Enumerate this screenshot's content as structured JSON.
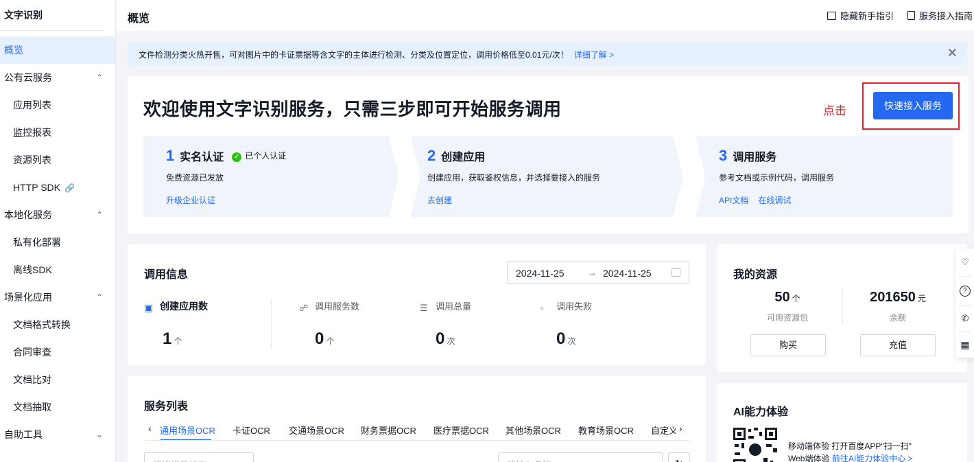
{
  "sidebar": {
    "title": "文字识别",
    "items": [
      {
        "label": "概览"
      },
      {
        "label": "公有云服务",
        "chevron": "^"
      },
      {
        "label": "应用列表"
      },
      {
        "label": "监控报表"
      },
      {
        "label": "资源列表"
      },
      {
        "label": "HTTP SDK"
      },
      {
        "label": "本地化服务",
        "chevron": "^"
      },
      {
        "label": "私有化部署"
      },
      {
        "label": "离线SDK"
      },
      {
        "label": "场景化应用",
        "chevron": "^"
      },
      {
        "label": "文档格式转换"
      },
      {
        "label": "合同审查"
      },
      {
        "label": "文档比对"
      },
      {
        "label": "文档抽取"
      },
      {
        "label": "自助工具",
        "chevron": "v"
      }
    ]
  },
  "header": {
    "title": "概览",
    "hide_guide": "隐藏新手指引",
    "service_guide": "服务接入指南"
  },
  "notice": {
    "text": "文件检测分类火热开售，可对图片中的卡证票据等含文字的主体进行检测、分类及位置定位，调用价格低至0.01元/次！",
    "link": "详细了解 >",
    "close": "✕"
  },
  "welcome": {
    "title": "欢迎使用文字识别服务，只需三步即可开始服务调用",
    "click_hint": "点击",
    "quick_button": "快速接入服务",
    "steps": [
      {
        "num": "1",
        "name": "实名认证",
        "badge": "已个人认证",
        "desc": "免费资源已发放",
        "links": [
          "升级企业认证"
        ]
      },
      {
        "num": "2",
        "name": "创建应用",
        "desc": "创建应用，获取鉴权信息，并选择要接入的服务",
        "links": [
          "去创建"
        ]
      },
      {
        "num": "3",
        "name": "调用服务",
        "desc": "参考文档或示例代码，调用服务",
        "links": [
          "API文档",
          "在线调试"
        ]
      }
    ]
  },
  "call_info": {
    "title": "调用信息",
    "date_start": "2024-11-25",
    "date_arrow": "→",
    "date_end": "2024-11-25",
    "metrics": [
      {
        "label": "创建应用数",
        "value": "1",
        "unit": "个"
      },
      {
        "label": "调用服务数",
        "value": "0",
        "unit": "个"
      },
      {
        "label": "调用总量",
        "value": "0",
        "unit": "次"
      },
      {
        "label": "调用失败",
        "value": "0",
        "unit": "次"
      }
    ]
  },
  "resources": {
    "title": "我的资源",
    "packages_value": "50",
    "packages_unit": "个",
    "packages_label": "可用资源包",
    "balance_value": "201650",
    "balance_unit": "元",
    "balance_label": "余额",
    "buy": "购买",
    "recharge": "充值"
  },
  "service_list": {
    "title": "服务列表",
    "tabs": [
      "通用场景OCR",
      "卡证OCR",
      "交通场景OCR",
      "财务票据OCR",
      "医疗票据OCR",
      "其他场景OCR",
      "教育场景OCR",
      "自定义"
    ],
    "select_placeholder": "请选择已状态",
    "search_placeholder": "请输入名称"
  },
  "ai": {
    "title": "AI能力体验",
    "mobile_text": "移动端体验 打开百度APP\"扫一扫\"",
    "web_text": "Web端体验",
    "web_link": "前往AI能力体验中心 >"
  }
}
